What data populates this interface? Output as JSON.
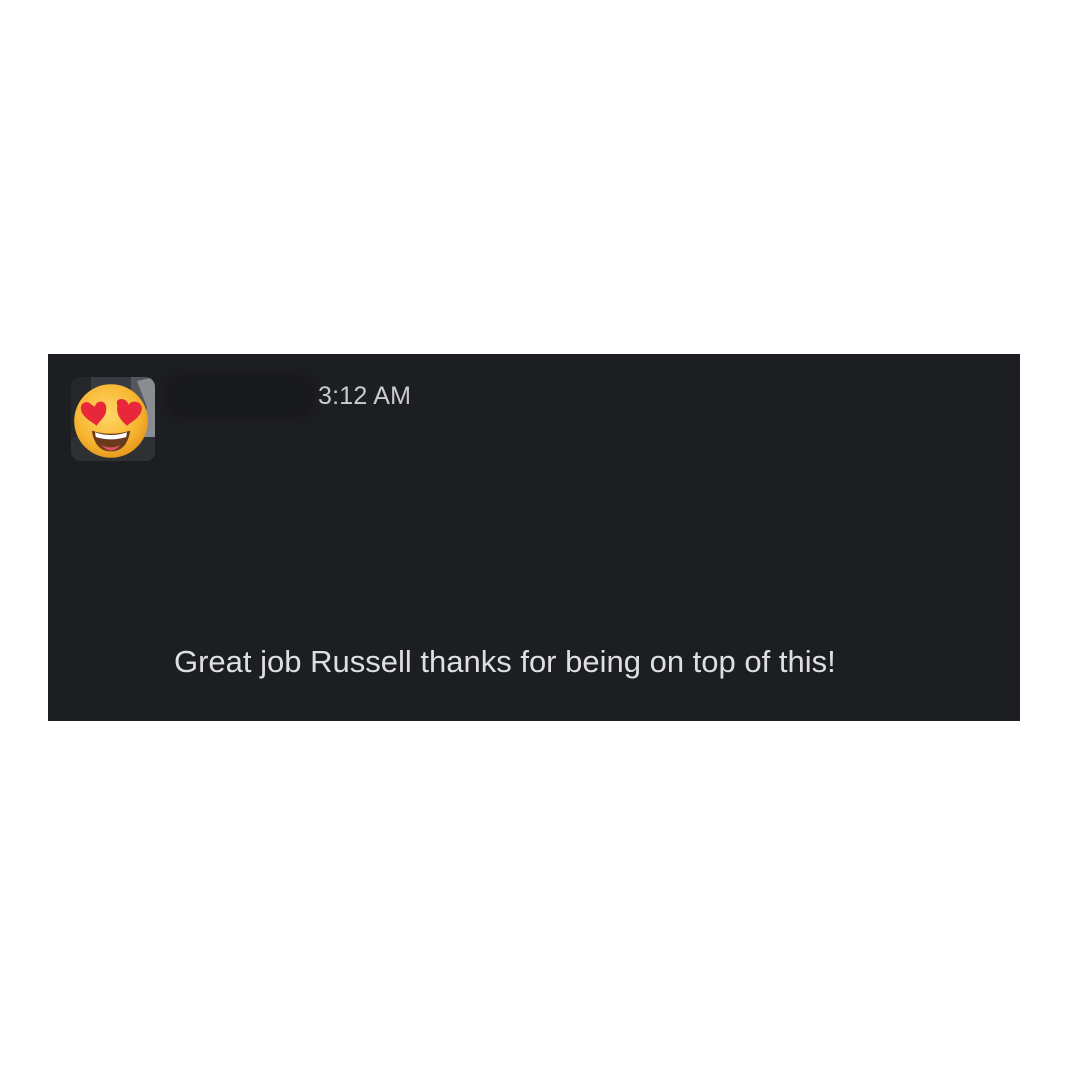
{
  "message": {
    "author": {
      "avatar_icon": "heart-eyes-emoji-icon",
      "name_redacted": true
    },
    "timestamp": "3:12 AM",
    "text": "Great job Russell thanks for being on top of this!"
  },
  "colors": {
    "panel_background": "#1d1e21",
    "page_background": "#ffffff",
    "timestamp": "#c9cbd0",
    "message_text": "#dedfe3"
  }
}
